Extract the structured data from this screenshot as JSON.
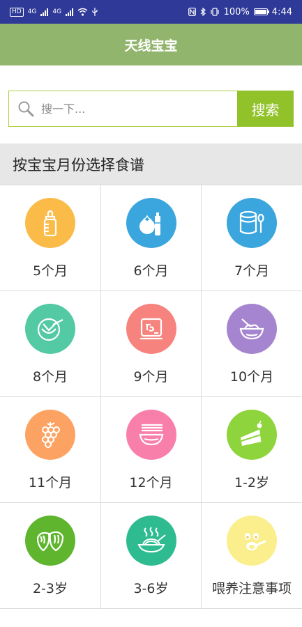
{
  "status_bar": {
    "left_chip": "HD",
    "network_1": "4G",
    "network_2": "4G",
    "battery_percent": "100%",
    "time": "4:44"
  },
  "app_title": "天线宝宝",
  "search": {
    "placeholder": "搜一下...",
    "button_label": "搜索"
  },
  "section_title": "按宝宝月份选择食谱",
  "colors": {
    "status_bar": "#2f3a98",
    "app_bar": "#92b56e",
    "search_button": "#92c22a",
    "search_border": "#a8cd3c"
  },
  "categories": [
    {
      "label": "5个月",
      "icon": "baby-bottle-icon",
      "color": "#fbbb48"
    },
    {
      "label": "6个月",
      "icon": "tomato-juice-icon",
      "color": "#3aa6dd"
    },
    {
      "label": "7个月",
      "icon": "milk-powder-can-icon",
      "color": "#3aa6dd"
    },
    {
      "label": "8个月",
      "icon": "bowl-spoon-icon",
      "color": "#53c9a4"
    },
    {
      "label": "9个月",
      "icon": "food-warmer-icon",
      "color": "#f6837e"
    },
    {
      "label": "10个月",
      "icon": "rice-bowl-icon",
      "color": "#a585cf"
    },
    {
      "label": "11个月",
      "icon": "grapes-icon",
      "color": "#fca363"
    },
    {
      "label": "12个月",
      "icon": "noodle-bowl-icon",
      "color": "#f97fab"
    },
    {
      "label": "1-2岁",
      "icon": "cake-icon",
      "color": "#8ed43c"
    },
    {
      "label": "2-3岁",
      "icon": "dumplings-icon",
      "color": "#5fb52e"
    },
    {
      "label": "3-6岁",
      "icon": "noodle-plate-icon",
      "color": "#2fbb90"
    },
    {
      "label": "喂养注意事项",
      "icon": "smiley-face-icon",
      "color": "#faef8c"
    }
  ]
}
